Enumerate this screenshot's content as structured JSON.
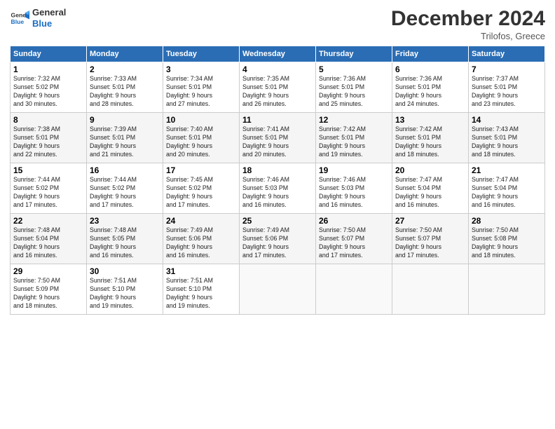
{
  "logo": {
    "line1": "General",
    "line2": "Blue"
  },
  "title": "December 2024",
  "subtitle": "Trilofos, Greece",
  "days_header": [
    "Sunday",
    "Monday",
    "Tuesday",
    "Wednesday",
    "Thursday",
    "Friday",
    "Saturday"
  ],
  "weeks": [
    [
      {
        "num": "1",
        "info": "Sunrise: 7:32 AM\nSunset: 5:02 PM\nDaylight: 9 hours\nand 30 minutes."
      },
      {
        "num": "2",
        "info": "Sunrise: 7:33 AM\nSunset: 5:01 PM\nDaylight: 9 hours\nand 28 minutes."
      },
      {
        "num": "3",
        "info": "Sunrise: 7:34 AM\nSunset: 5:01 PM\nDaylight: 9 hours\nand 27 minutes."
      },
      {
        "num": "4",
        "info": "Sunrise: 7:35 AM\nSunset: 5:01 PM\nDaylight: 9 hours\nand 26 minutes."
      },
      {
        "num": "5",
        "info": "Sunrise: 7:36 AM\nSunset: 5:01 PM\nDaylight: 9 hours\nand 25 minutes."
      },
      {
        "num": "6",
        "info": "Sunrise: 7:36 AM\nSunset: 5:01 PM\nDaylight: 9 hours\nand 24 minutes."
      },
      {
        "num": "7",
        "info": "Sunrise: 7:37 AM\nSunset: 5:01 PM\nDaylight: 9 hours\nand 23 minutes."
      }
    ],
    [
      {
        "num": "8",
        "info": "Sunrise: 7:38 AM\nSunset: 5:01 PM\nDaylight: 9 hours\nand 22 minutes."
      },
      {
        "num": "9",
        "info": "Sunrise: 7:39 AM\nSunset: 5:01 PM\nDaylight: 9 hours\nand 21 minutes."
      },
      {
        "num": "10",
        "info": "Sunrise: 7:40 AM\nSunset: 5:01 PM\nDaylight: 9 hours\nand 20 minutes."
      },
      {
        "num": "11",
        "info": "Sunrise: 7:41 AM\nSunset: 5:01 PM\nDaylight: 9 hours\nand 20 minutes."
      },
      {
        "num": "12",
        "info": "Sunrise: 7:42 AM\nSunset: 5:01 PM\nDaylight: 9 hours\nand 19 minutes."
      },
      {
        "num": "13",
        "info": "Sunrise: 7:42 AM\nSunset: 5:01 PM\nDaylight: 9 hours\nand 18 minutes."
      },
      {
        "num": "14",
        "info": "Sunrise: 7:43 AM\nSunset: 5:01 PM\nDaylight: 9 hours\nand 18 minutes."
      }
    ],
    [
      {
        "num": "15",
        "info": "Sunrise: 7:44 AM\nSunset: 5:02 PM\nDaylight: 9 hours\nand 17 minutes."
      },
      {
        "num": "16",
        "info": "Sunrise: 7:44 AM\nSunset: 5:02 PM\nDaylight: 9 hours\nand 17 minutes."
      },
      {
        "num": "17",
        "info": "Sunrise: 7:45 AM\nSunset: 5:02 PM\nDaylight: 9 hours\nand 17 minutes."
      },
      {
        "num": "18",
        "info": "Sunrise: 7:46 AM\nSunset: 5:03 PM\nDaylight: 9 hours\nand 16 minutes."
      },
      {
        "num": "19",
        "info": "Sunrise: 7:46 AM\nSunset: 5:03 PM\nDaylight: 9 hours\nand 16 minutes."
      },
      {
        "num": "20",
        "info": "Sunrise: 7:47 AM\nSunset: 5:04 PM\nDaylight: 9 hours\nand 16 minutes."
      },
      {
        "num": "21",
        "info": "Sunrise: 7:47 AM\nSunset: 5:04 PM\nDaylight: 9 hours\nand 16 minutes."
      }
    ],
    [
      {
        "num": "22",
        "info": "Sunrise: 7:48 AM\nSunset: 5:04 PM\nDaylight: 9 hours\nand 16 minutes."
      },
      {
        "num": "23",
        "info": "Sunrise: 7:48 AM\nSunset: 5:05 PM\nDaylight: 9 hours\nand 16 minutes."
      },
      {
        "num": "24",
        "info": "Sunrise: 7:49 AM\nSunset: 5:06 PM\nDaylight: 9 hours\nand 16 minutes."
      },
      {
        "num": "25",
        "info": "Sunrise: 7:49 AM\nSunset: 5:06 PM\nDaylight: 9 hours\nand 17 minutes."
      },
      {
        "num": "26",
        "info": "Sunrise: 7:50 AM\nSunset: 5:07 PM\nDaylight: 9 hours\nand 17 minutes."
      },
      {
        "num": "27",
        "info": "Sunrise: 7:50 AM\nSunset: 5:07 PM\nDaylight: 9 hours\nand 17 minutes."
      },
      {
        "num": "28",
        "info": "Sunrise: 7:50 AM\nSunset: 5:08 PM\nDaylight: 9 hours\nand 18 minutes."
      }
    ],
    [
      {
        "num": "29",
        "info": "Sunrise: 7:50 AM\nSunset: 5:09 PM\nDaylight: 9 hours\nand 18 minutes."
      },
      {
        "num": "30",
        "info": "Sunrise: 7:51 AM\nSunset: 5:10 PM\nDaylight: 9 hours\nand 19 minutes."
      },
      {
        "num": "31",
        "info": "Sunrise: 7:51 AM\nSunset: 5:10 PM\nDaylight: 9 hours\nand 19 minutes."
      },
      {
        "num": "",
        "info": ""
      },
      {
        "num": "",
        "info": ""
      },
      {
        "num": "",
        "info": ""
      },
      {
        "num": "",
        "info": ""
      }
    ]
  ]
}
